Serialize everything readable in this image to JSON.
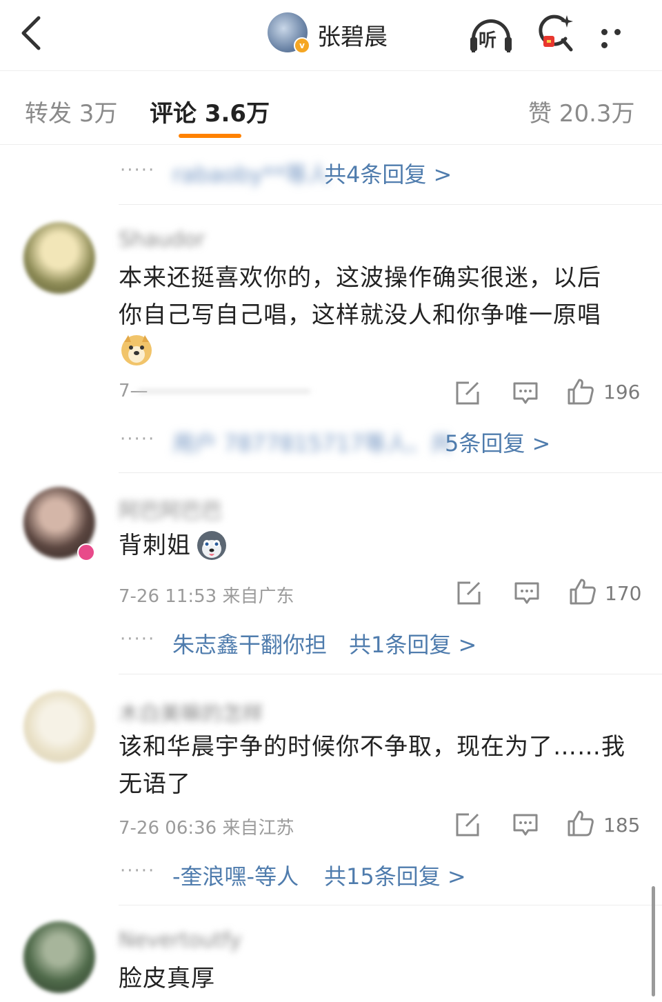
{
  "header": {
    "back_icon": "chevron-left-icon",
    "title": "张碧晨",
    "listen_label": "听",
    "search_icon": "search-sparkle-icon",
    "more_icon": "more-dots-icon"
  },
  "tabs": [
    {
      "label": "转发 3万",
      "active": false
    },
    {
      "label": "评论 3.6万",
      "active": true
    },
    {
      "label": "赞 20.3万",
      "active": false
    }
  ],
  "accent_color": "#ff8200",
  "link_color": "#4f7cad",
  "top_reply": {
    "dots": "·····",
    "users": "rabaoby**等人",
    "count": "共4条回复 >"
  },
  "comments": [
    {
      "username": "Shaudor",
      "content_line1": "本来还挺喜欢你的，这波操作确实很迷，以后",
      "content_line2": "你自己写自己唱，这样就没人和你争唯一原唱",
      "meta": "7—",
      "likes": "196",
      "reply_dots": "·····",
      "reply_users": "用户 7877815717等人、共",
      "reply_count": "5条回复 >"
    },
    {
      "username": "阿巴阿巴巴",
      "content": "背刺姐",
      "meta": "7-26 11:53 来自广东",
      "likes": "170",
      "reply_dots": "·····",
      "reply_users": "朱志鑫干翻你担",
      "reply_count": "共1条回复 >"
    },
    {
      "username": "木白美嘛的怎样",
      "content_line1": "该和华晨宇争的时候你不争取，现在为了……我",
      "content_line2": "无语了",
      "meta": "7-26 06:36 来自江苏",
      "likes": "185",
      "reply_dots": "·····",
      "reply_users": "-奎浪嘿-等人",
      "reply_count": "共15条回复 >"
    },
    {
      "username": "Nevertoutfy",
      "content": "脸皮真厚"
    }
  ]
}
